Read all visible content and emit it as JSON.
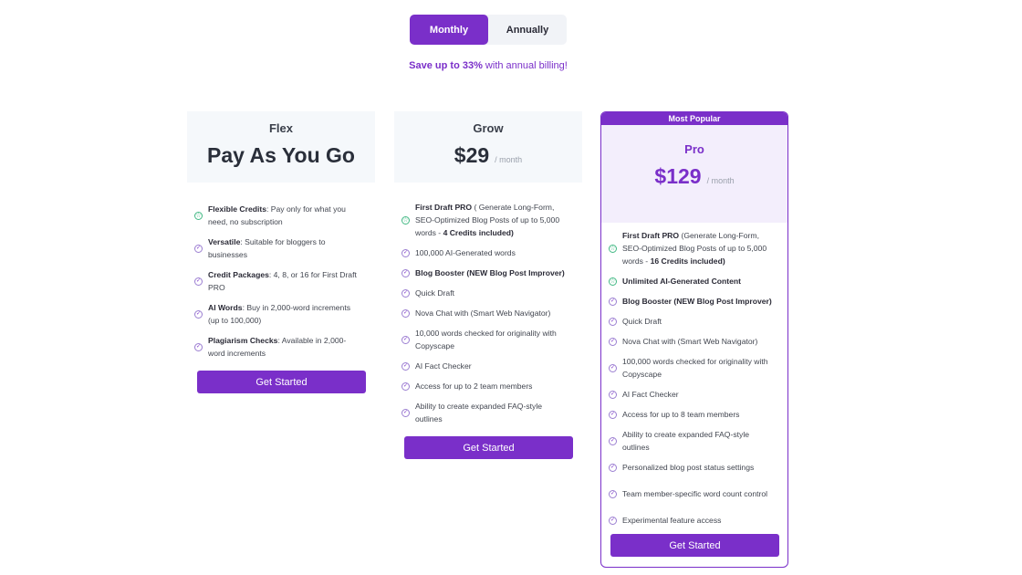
{
  "billing": {
    "monthly_label": "Monthly",
    "annually_label": "Annually",
    "save_prefix": "Save up to 33%",
    "save_suffix": " with annual billing!"
  },
  "plans": {
    "flex": {
      "name": "Flex",
      "headline": "Pay As You Go",
      "cta": "Get Started",
      "features": [
        {
          "bold": "Flexible Credits",
          "rest": ": Pay only for what you need, no subscription",
          "icon": "star-icon"
        },
        {
          "bold": "Versatile",
          "rest": ": Suitable for bloggers to businesses",
          "icon": "check-icon"
        },
        {
          "bold": "Credit Packages",
          "rest": ": 4, 8, or 16 for First Draft PRO",
          "icon": "check-icon"
        },
        {
          "bold": "AI Words",
          "rest": ": Buy in 2,000-word increments (up to 100,000)",
          "icon": "check-icon"
        },
        {
          "bold": "Plagiarism Checks",
          "rest": ": Available in 2,000-word increments",
          "icon": "check-icon"
        }
      ]
    },
    "grow": {
      "name": "Grow",
      "price": "$29",
      "period": "/ month",
      "cta": "Get Started",
      "features": [
        {
          "bold": "First Draft PRO",
          "rest": " ( Generate Long-Form, SEO-Optimized Blog Posts of up to 5,000 words - ",
          "bold2": "4 Credits included)",
          "icon": "star-icon"
        },
        {
          "bold": "",
          "rest": "100,000 AI-Generated words",
          "icon": "check-icon"
        },
        {
          "bold": "Blog Booster (NEW Blog Post Improver)",
          "rest": "",
          "icon": "check-icon"
        },
        {
          "bold": "",
          "rest": "Quick Draft",
          "icon": "check-icon"
        },
        {
          "bold": "",
          "rest": "Nova Chat with (Smart Web Navigator)",
          "icon": "check-icon"
        },
        {
          "bold": "",
          "rest": "10,000 words checked for originality with Copyscape",
          "icon": "check-icon"
        },
        {
          "bold": "",
          "rest": "AI Fact Checker",
          "icon": "check-icon"
        },
        {
          "bold": "",
          "rest": "Access for up to 2 team members",
          "icon": "check-icon"
        },
        {
          "bold": "",
          "rest": "Ability to create expanded FAQ-style outlines",
          "icon": "check-icon"
        }
      ]
    },
    "pro": {
      "badge": "Most Popular",
      "name": "Pro",
      "price": "$129",
      "period": "/ month",
      "cta": "Get Started",
      "features": [
        {
          "bold": "First Draft PRO",
          "rest": " (Generate Long-Form, SEO-Optimized Blog Posts of up to 5,000 words - ",
          "bold2": "16 Credits included)",
          "icon": "star-icon"
        },
        {
          "bold": "Unlimited AI-Generated Content",
          "rest": "",
          "icon": "star-icon"
        },
        {
          "bold": "Blog Booster (NEW Blog Post Improver)",
          "rest": "",
          "icon": "check-icon"
        },
        {
          "bold": "",
          "rest": "Quick Draft",
          "icon": "check-icon"
        },
        {
          "bold": "",
          "rest": "Nova Chat with (Smart Web Navigator)",
          "icon": "check-icon"
        },
        {
          "bold": "",
          "rest": "100,000 words checked for originality with Copyscape",
          "icon": "check-icon"
        },
        {
          "bold": "",
          "rest": "AI Fact Checker",
          "icon": "check-icon"
        },
        {
          "bold": "",
          "rest": "Access for up to 8 team members",
          "icon": "check-icon"
        },
        {
          "bold": "",
          "rest": "Ability to create expanded FAQ-style outlines",
          "icon": "check-icon"
        },
        {
          "bold": "",
          "rest": "Personalized blog post status settings",
          "icon": "check-icon"
        },
        {
          "bold": "",
          "rest": "Team member-specific word count control",
          "icon": "check-icon"
        },
        {
          "bold": "",
          "rest": "Experimental feature access",
          "icon": "check-icon"
        }
      ]
    }
  },
  "colors": {
    "accent": "#7a2fc9",
    "card_head": "#f5f8fb",
    "pro_head": "#f3eefc",
    "star": "#41b883"
  }
}
